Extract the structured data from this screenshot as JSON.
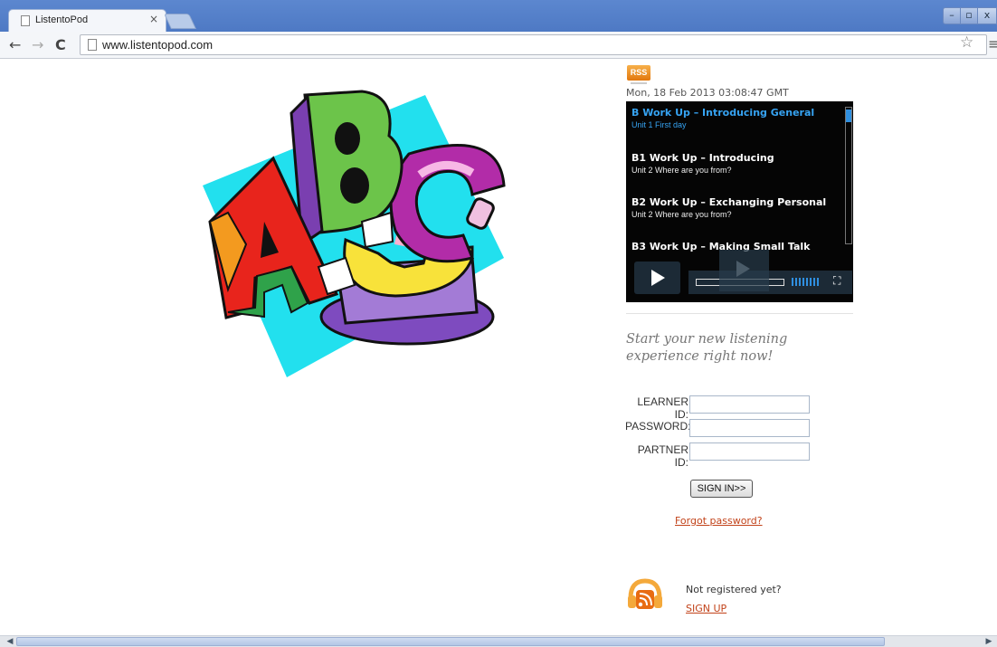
{
  "browser": {
    "tab_title": "ListentoPod",
    "tab_close": "×",
    "url": "www.listentopod.com",
    "nav": {
      "back": "←",
      "forward": "→",
      "reload": "C"
    },
    "star": "☆",
    "menu": "≡",
    "window": {
      "minimize": "–",
      "maximize": "▫",
      "close": "x"
    }
  },
  "feed": {
    "rss_label": "RSS",
    "date": "Mon, 18 Feb 2013 03:08:47 GMT",
    "episodes": [
      {
        "title": "B Work Up – Introducing General",
        "subtitle": "Unit 1  First day"
      },
      {
        "title": "B1 Work Up – Introducing",
        "subtitle": "Unit 2  Where are you from?"
      },
      {
        "title": "B2 Work Up – Exchanging Personal",
        "subtitle": "Unit 2  Where are you from?"
      },
      {
        "title": "B3 Work Up – Making Small Talk",
        "subtitle": ""
      }
    ],
    "fullscreen_glyph": "⛶"
  },
  "login": {
    "tagline": "Start your new listening experience right now!",
    "learner_label": "LEARNER ID:",
    "password_label": "PASSWORD:",
    "partner_label": "PARTNER ID:",
    "signin_label": "SIGN IN>>",
    "forgot_label": "Forgot password?"
  },
  "register": {
    "prompt": "Not registered yet?",
    "signup_label": "SIGN UP"
  },
  "icons": {
    "logo": "abc-logo-icon",
    "podcast": "podcast-rss-icon"
  },
  "colors": {
    "link": "#c2431a",
    "active_episode": "#36a3f2",
    "player_bg": "#050505",
    "rss_orange": "#e2780e"
  }
}
